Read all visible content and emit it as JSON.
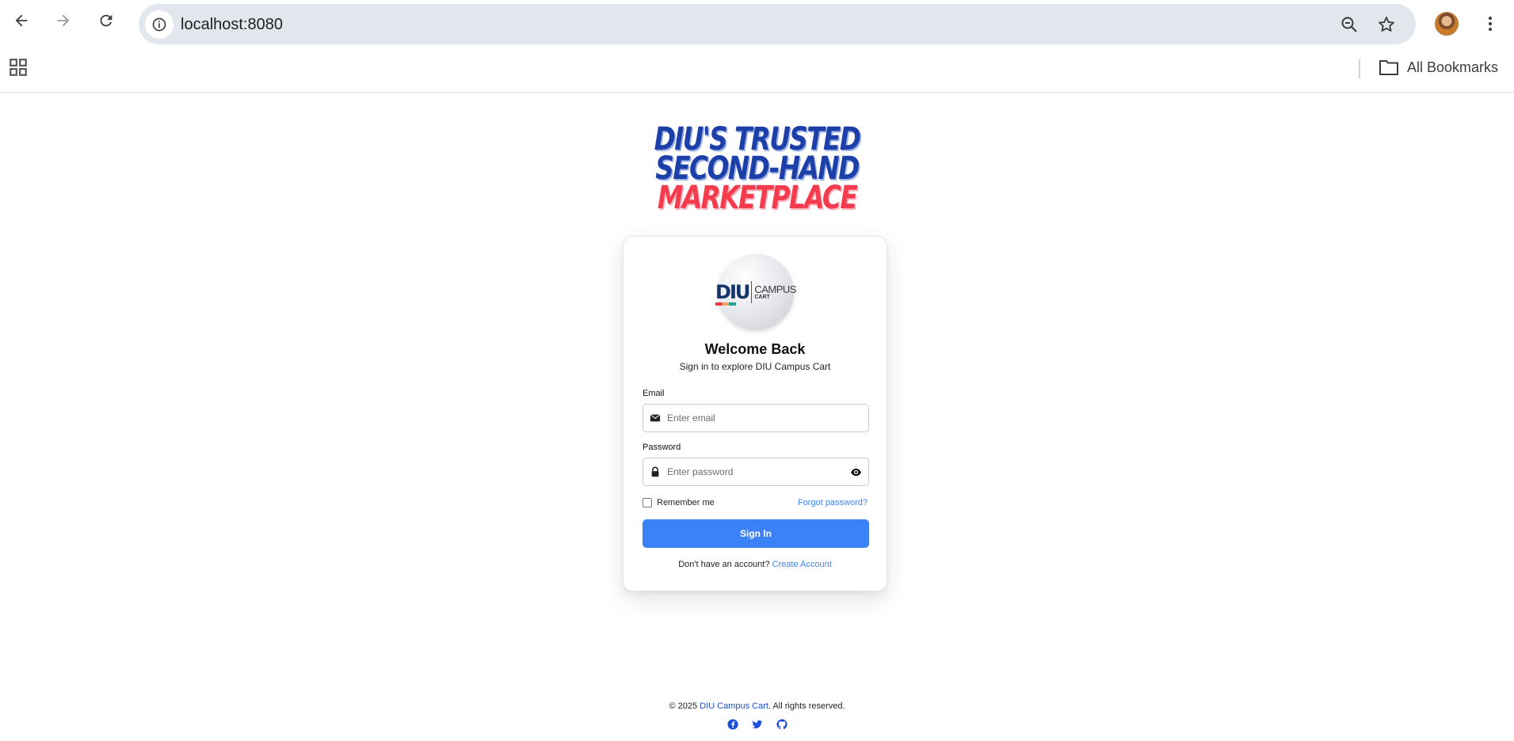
{
  "browser": {
    "url": "localhost:8080",
    "all_bookmarks_label": "All Bookmarks"
  },
  "hero": {
    "line1": "DIU'S TRUSTED",
    "line2": "SECOND-HAND",
    "line3": "MARKETPLACE"
  },
  "logo": {
    "mark": "DIU",
    "word1": "CAMPUS",
    "word2": "CART"
  },
  "login": {
    "title": "Welcome Back",
    "subtitle": "Sign in to explore DIU Campus Cart",
    "email_label": "Email",
    "email_value": "",
    "email_placeholder": "Enter email",
    "password_label": "Password",
    "password_value": "",
    "password_placeholder": "Enter password",
    "remember_label": "Remember me",
    "remember_checked": false,
    "forgot_label": "Forgot password?",
    "signin_label": "Sign In",
    "no_account_text": "Don't have an account?",
    "create_account_label": "Create Account"
  },
  "footer": {
    "copyright_prefix": "© 2025",
    "brand_link": "DIU Campus Cart",
    "copyright_suffix": ". All rights reserved.",
    "social": [
      "facebook-icon",
      "twitter-icon",
      "github-icon"
    ]
  },
  "colors": {
    "primary": "#3b82f6",
    "hero_blue": "#1d3fa8",
    "hero_red": "#f53b4e",
    "omnibox_bg": "#e2e6ed"
  }
}
